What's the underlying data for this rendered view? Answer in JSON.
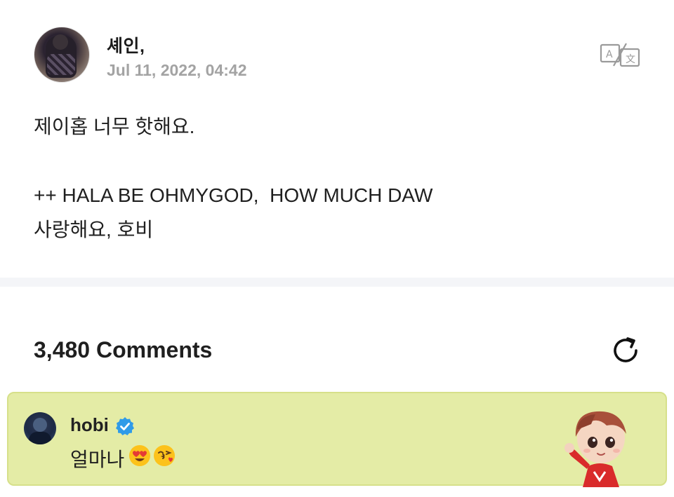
{
  "post": {
    "author": "셰인,",
    "date": "Jul 11, 2022, 04:42",
    "body_lines": [
      "제이홉 너무 핫해요.",
      "",
      "++ HALA BE OHMYGOD,  HOW MUCH DAW",
      "사랑해요, 호비"
    ]
  },
  "icons": {
    "translate": "translate-icon",
    "refresh": "refresh-icon",
    "verified": "verified-badge-icon"
  },
  "comments": {
    "title": "3,480 Comments"
  },
  "pinned_comment": {
    "author": "hobi",
    "text": "얼마나",
    "emojis": [
      "heart-eyes-emoji",
      "kiss-emoji"
    ]
  },
  "colors": {
    "pinned_bg": "#e4eca6",
    "verified": "#2f9be8",
    "divider": "#f4f5f8",
    "date_gray": "#a3a3a3"
  }
}
